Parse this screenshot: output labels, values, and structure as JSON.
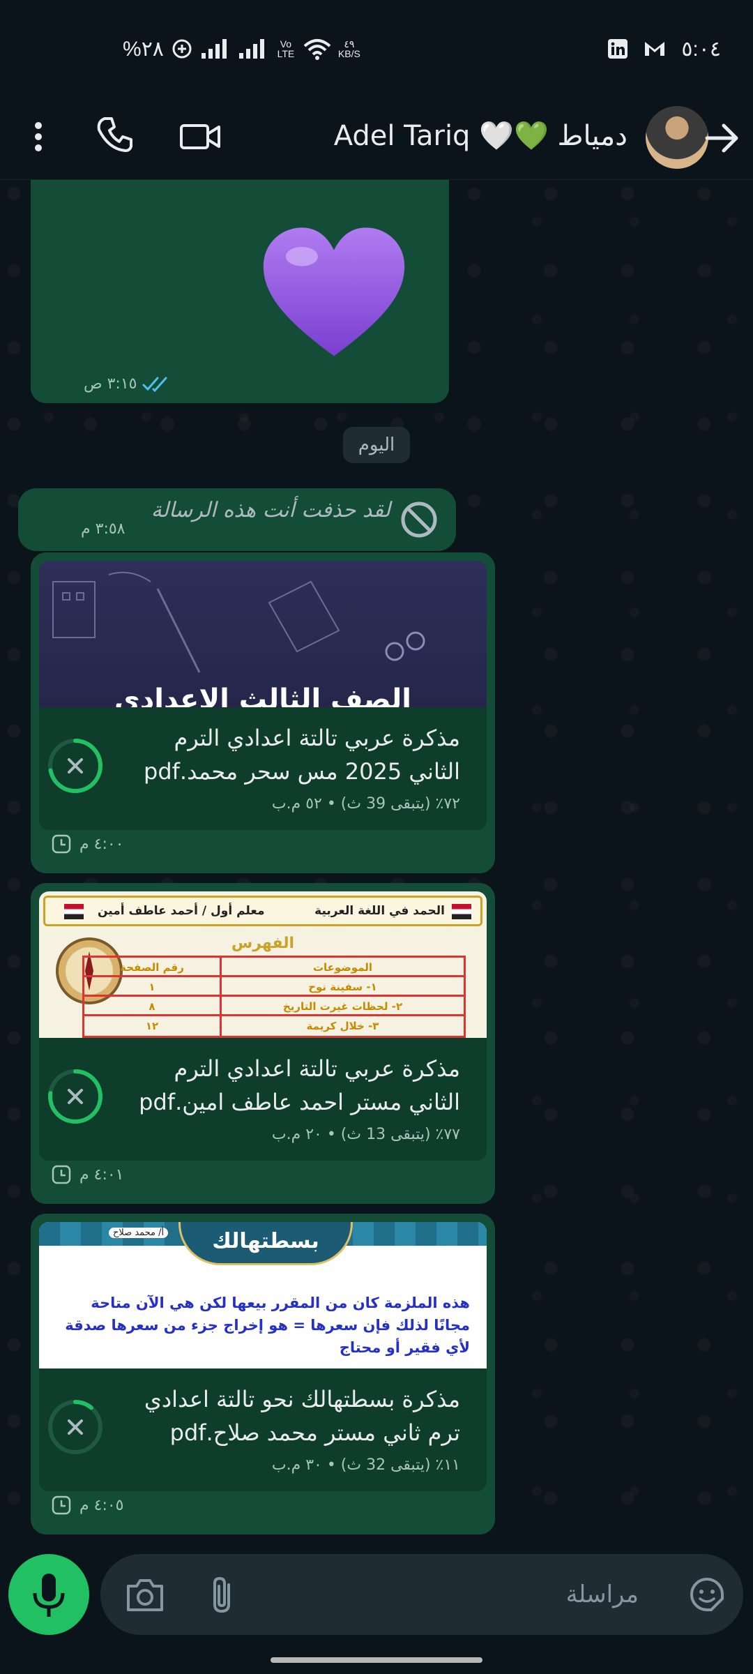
{
  "status_bar": {
    "battery": "%٢٨",
    "net_speed_value": "٤٩",
    "net_speed_unit": "KB/S",
    "volte": "Vo LTE",
    "time": "٥:٠٤"
  },
  "header": {
    "contact_name": "Adel Tariq 🤍💚 دمياط"
  },
  "messages": {
    "heart": {
      "emoji": "💜",
      "time": "٣:١٥ ص"
    },
    "date_separator": "اليوم",
    "deleted": {
      "text": "لقد حذفت أنت هذه الرسالة",
      "time": "٣:٥٨ م"
    },
    "docs": [
      {
        "preview_title": "الصف الثالث الاعدادي",
        "title": "مذكرة عربي تالتة اعدادي الترم الثاني 2025 مس سحر محمد.pdf",
        "meta": "٧٢٪ (يتبقى 39 ث) • ٥٢ م.ب",
        "progress": 0.72,
        "time": "٤:٠٠ م"
      },
      {
        "preview_header_right": "الحمد في اللغة العربية",
        "preview_header_left": "معلم أول / أحمد عاطف أمين",
        "preview_index_title": "الفهرس",
        "preview_col_topics": "الموضوعات",
        "preview_col_page": "رقم الصفحة",
        "preview_rows": [
          {
            "topic": "١- سفينة نوح",
            "page": "١"
          },
          {
            "topic": "٢- لحظات غيرت التاريخ",
            "page": "٨"
          },
          {
            "topic": "٣- خلال كريمة",
            "page": "١٢"
          }
        ],
        "title": "مذكرة عربي تالتة اعدادي الترم الثاني مستر احمد عاطف امين.pdf",
        "meta": "٧٧٪ (يتبقى 13 ث) • ٢٠ م.ب",
        "progress": 0.77,
        "time": "٤:٠١ م"
      },
      {
        "preview_banner": "بسطتهالك",
        "preview_author": "أ/ محمد صلاح",
        "preview_text": "هذه الملزمة كان من المقرر بيعها لكن هي الآن متاحة مجانًا لذلك فإن سعرها = هو إخراج جزء من سعرها صدقة لأي فقير أو محتاج",
        "title": "مذكرة بسطتهالك نحو تالتة اعدادي ترم ثاني مستر محمد صلاح.pdf",
        "meta": "١١٪ (يتبقى 32 ث) • ٣٠ م.ب",
        "progress": 0.11,
        "time": "٤:٠٥ م"
      }
    ]
  },
  "input": {
    "placeholder": "مراسلة"
  },
  "colors": {
    "bubble": "#144d37",
    "accent": "#21c063",
    "background": "#0b141a"
  }
}
